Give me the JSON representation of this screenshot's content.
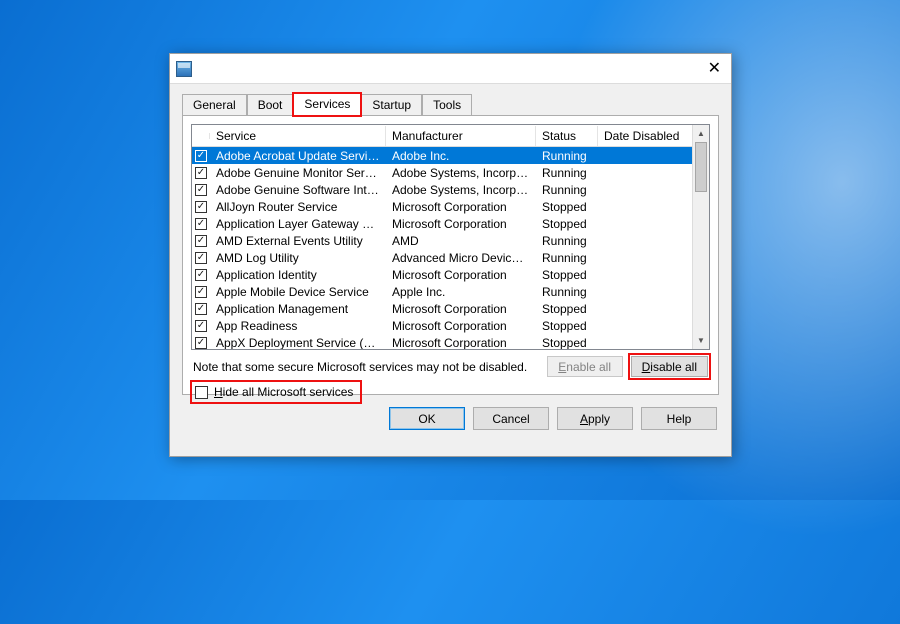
{
  "tabs": [
    "General",
    "Boot",
    "Services",
    "Startup",
    "Tools"
  ],
  "active_tab": 2,
  "columns": [
    "Service",
    "Manufacturer",
    "Status",
    "Date Disabled"
  ],
  "rows": [
    {
      "checked": true,
      "service": "Adobe Acrobat Update Service",
      "mfr": "Adobe Inc.",
      "status": "Running",
      "date": "",
      "selected": true
    },
    {
      "checked": true,
      "service": "Adobe Genuine Monitor Service",
      "mfr": "Adobe Systems, Incorpora...",
      "status": "Running",
      "date": ""
    },
    {
      "checked": true,
      "service": "Adobe Genuine Software Integri...",
      "mfr": "Adobe Systems, Incorpora...",
      "status": "Running",
      "date": ""
    },
    {
      "checked": true,
      "service": "AllJoyn Router Service",
      "mfr": "Microsoft Corporation",
      "status": "Stopped",
      "date": ""
    },
    {
      "checked": true,
      "service": "Application Layer Gateway Service",
      "mfr": "Microsoft Corporation",
      "status": "Stopped",
      "date": ""
    },
    {
      "checked": true,
      "service": "AMD External Events Utility",
      "mfr": "AMD",
      "status": "Running",
      "date": ""
    },
    {
      "checked": true,
      "service": "AMD Log Utility",
      "mfr": "Advanced Micro Devices, I...",
      "status": "Running",
      "date": ""
    },
    {
      "checked": true,
      "service": "Application Identity",
      "mfr": "Microsoft Corporation",
      "status": "Stopped",
      "date": ""
    },
    {
      "checked": true,
      "service": "Apple Mobile Device Service",
      "mfr": "Apple Inc.",
      "status": "Running",
      "date": ""
    },
    {
      "checked": true,
      "service": "Application Management",
      "mfr": "Microsoft Corporation",
      "status": "Stopped",
      "date": ""
    },
    {
      "checked": true,
      "service": "App Readiness",
      "mfr": "Microsoft Corporation",
      "status": "Stopped",
      "date": ""
    },
    {
      "checked": true,
      "service": "AppX Deployment Service (AppX...",
      "mfr": "Microsoft Corporation",
      "status": "Stopped",
      "date": ""
    }
  ],
  "note_text": "Note that some secure Microsoft services may not be disabled.",
  "enable_all_label": "Enable all",
  "disable_all_label": "Disable all",
  "hide_ms_label_pre": "H",
  "hide_ms_label_post": "ide all Microsoft services",
  "buttons": {
    "ok": "OK",
    "cancel": "Cancel",
    "apply": "Apply",
    "help": "Help"
  }
}
